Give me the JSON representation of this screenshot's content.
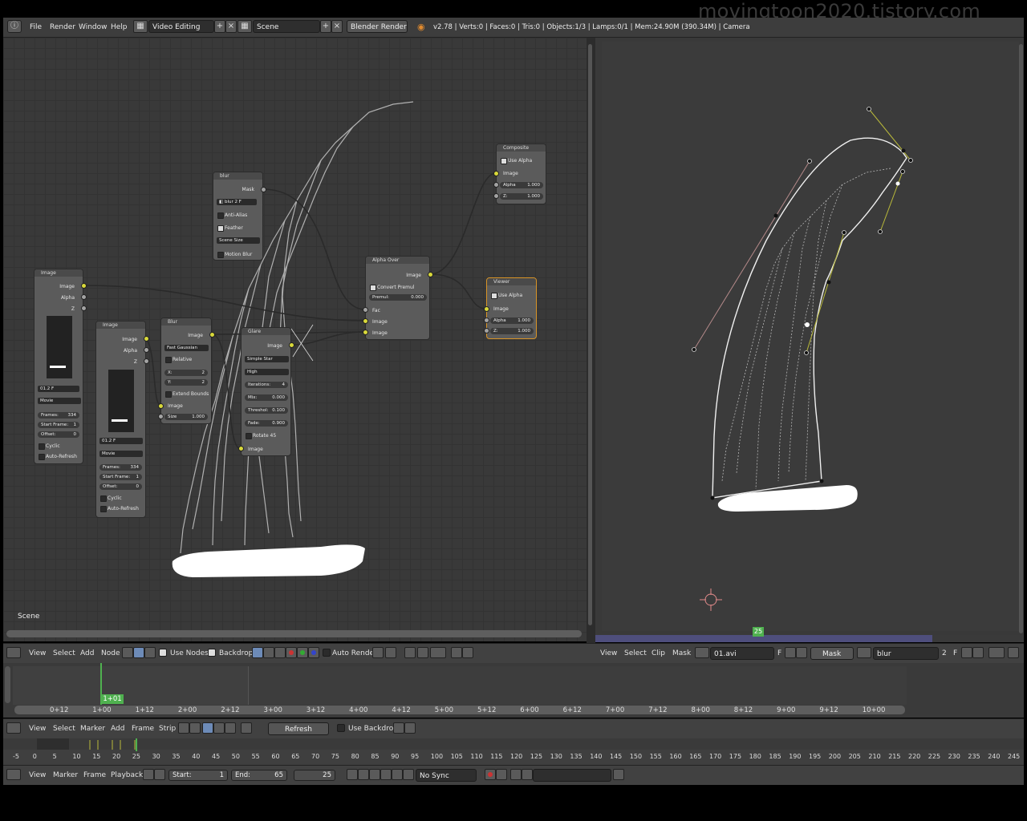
{
  "watermark": "movingtoon2020.tistory.com",
  "topbar": {
    "menu": [
      "File",
      "Render",
      "Window",
      "Help"
    ],
    "layout": "Video Editing",
    "scene": "Scene",
    "engine": "Blender Render",
    "stats": "v2.78 | Verts:0 | Faces:0 | Tris:0 | Objects:1/3 | Lamps:0/1 | Mem:24.90M (390.34M) | Camera"
  },
  "node_editor": {
    "scene_label": "Scene",
    "nodes": {
      "image1": {
        "title": "Image",
        "out_image": "Image",
        "out_alpha": "Alpha",
        "out_z": "Z",
        "file": "01.2",
        "f_btn": "F",
        "source": "Movie",
        "frames_label": "Frames:",
        "frames": "334",
        "start_label": "Start Frame:",
        "start": "1",
        "offset_label": "Offset:",
        "offset": "0",
        "cyclic": "Cyclic",
        "auto_refresh": "Auto-Refresh"
      },
      "image2": {
        "title": "Image",
        "out_image": "Image",
        "out_alpha": "Alpha",
        "out_z": "Z",
        "file": "01.2",
        "f_btn": "F",
        "source": "Movie",
        "frames_label": "Frames:",
        "frames": "334",
        "start_label": "Start Frame:",
        "start": "1",
        "offset_label": "Offset:",
        "offset": "0",
        "cyclic": "Cyclic",
        "auto_refresh": "Auto-Refresh"
      },
      "mask": {
        "title": "blur",
        "out_mask": "Mask",
        "name": "blur",
        "num": "2",
        "f_btn": "F",
        "anti_alias": "Anti-Alias",
        "feather": "Feather",
        "size_mode": "Scene Size",
        "motion_blur": "Motion Blur"
      },
      "blur": {
        "title": "Blur",
        "out_image": "Image",
        "filter": "Fast Gaussian",
        "relative": "Relative",
        "x_label": "X:",
        "x": "2",
        "y_label": "Y:",
        "y": "2",
        "extend": "Extend Bounds",
        "in_image": "Image",
        "size_label": "Size",
        "size": "1.000"
      },
      "glare": {
        "title": "Glare",
        "out_image": "Image",
        "type": "Simple Star",
        "quality": "High",
        "iter_label": "Iterations:",
        "iter": "4",
        "mix_label": "Mix:",
        "mix": "0.000",
        "thresh_label": "Threshol:",
        "thresh": "0.100",
        "fade_label": "Fade:",
        "fade": "0.900",
        "rotate": "Rotate 45",
        "in_image": "Image"
      },
      "alphaover": {
        "title": "Alpha Over",
        "out_image": "Image",
        "convert": "Convert Premul",
        "premul_label": "Premul:",
        "premul": "0.000",
        "fac": "Fac",
        "in1": "Image",
        "in2": "Image"
      },
      "composite": {
        "title": "Composite",
        "use_alpha": "Use Alpha",
        "in_image": "Image",
        "alpha_label": "Alpha",
        "alpha": "1.000",
        "z_label": "Z:",
        "z": "1.000"
      },
      "viewer": {
        "title": "Viewer",
        "use_alpha": "Use Alpha",
        "in_image": "Image",
        "alpha_label": "Alpha",
        "alpha": "1.000",
        "z_label": "Z:",
        "z": "1.000"
      }
    },
    "header": {
      "view": "View",
      "select": "Select",
      "add": "Add",
      "node": "Node",
      "use_nodes": "Use Nodes",
      "backdrop": "Backdrop",
      "auto_render": "Auto Render"
    }
  },
  "clip_editor": {
    "current_frame": "25",
    "header": {
      "view": "View",
      "select": "Select",
      "clip": "Clip",
      "mask": "Mask",
      "clip_name": "01.avi",
      "f_btn": "F",
      "mode": "Mask",
      "mask_name": "blur",
      "num": "2",
      "f_btn2": "F"
    }
  },
  "sequencer": {
    "strip_label": "1+01",
    "ruler": [
      "0+12",
      "1+00",
      "1+12",
      "2+00",
      "2+12",
      "3+00",
      "3+12",
      "4+00",
      "4+12",
      "5+00",
      "5+12",
      "6+00",
      "6+12",
      "7+00",
      "7+12",
      "8+00",
      "8+12",
      "9+00",
      "9+12",
      "10+00"
    ],
    "header": {
      "view": "View",
      "select": "Select",
      "marker": "Marker",
      "add": "Add",
      "frame": "Frame",
      "strip": "Strip",
      "refresh": "Refresh Sequencer",
      "use_backdrop": "Use Backdrop"
    }
  },
  "timeline": {
    "ruler": [
      "-5",
      "0",
      "5",
      "10",
      "15",
      "20",
      "25",
      "30",
      "35",
      "40",
      "45",
      "50",
      "55",
      "60",
      "65",
      "70",
      "75",
      "80",
      "85",
      "90",
      "95",
      "100",
      "105",
      "110",
      "115",
      "120",
      "125",
      "130",
      "135",
      "140",
      "145",
      "150",
      "155",
      "160",
      "165",
      "170",
      "175",
      "180",
      "185",
      "190",
      "195",
      "200",
      "205",
      "210",
      "215",
      "220",
      "225",
      "230",
      "235",
      "240",
      "245"
    ],
    "header": {
      "view": "View",
      "marker": "Marker",
      "frame": "Frame",
      "playback": "Playback",
      "start_label": "Start:",
      "start": "1",
      "end_label": "End:",
      "end": "65",
      "current": "25",
      "sync": "No Sync"
    }
  }
}
